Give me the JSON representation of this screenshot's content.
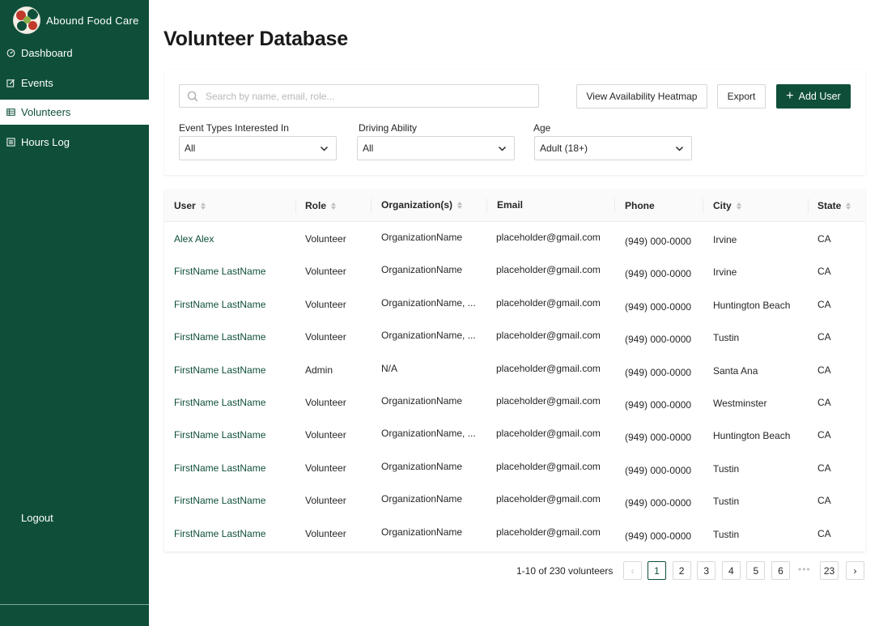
{
  "app": {
    "name": "Abound Food Care"
  },
  "sidebar": {
    "items": [
      {
        "label": "Dashboard",
        "icon": "dashboard-icon",
        "active": false
      },
      {
        "label": "Events",
        "icon": "edit-icon",
        "active": false
      },
      {
        "label": "Volunteers",
        "icon": "table-icon",
        "active": true
      },
      {
        "label": "Hours Log",
        "icon": "log-icon",
        "active": false
      }
    ],
    "logout": "Logout"
  },
  "page": {
    "title": "Volunteer Database"
  },
  "toolbar": {
    "search_placeholder": "Search by name, email, role...",
    "heatmap_label": "View Availability Heatmap",
    "export_label": "Export",
    "add_label": "Add User"
  },
  "filters": {
    "event_types": {
      "label": "Event Types Interested In",
      "value": "All"
    },
    "driving": {
      "label": "Driving Ability",
      "value": "All"
    },
    "age": {
      "label": "Age",
      "value": "Adult (18+)"
    }
  },
  "table": {
    "columns": [
      "User",
      "Role",
      "Organization(s)",
      "Email",
      "Phone",
      "City",
      "State"
    ],
    "rows": [
      {
        "user": "Alex Alex",
        "role": "Volunteer",
        "org": "OrganizationName",
        "email": "placeholder@gmail.com",
        "phone": "(949) 000-0000",
        "city": "Irvine",
        "state": "CA"
      },
      {
        "user": "FirstName LastName",
        "role": "Volunteer",
        "org": "OrganizationName",
        "email": "placeholder@gmail.com",
        "phone": "(949) 000-0000",
        "city": "Irvine",
        "state": "CA"
      },
      {
        "user": "FirstName LastName",
        "role": "Volunteer",
        "org": "OrganizationName, ...",
        "email": "placeholder@gmail.com",
        "phone": "(949) 000-0000",
        "city": "Huntington Beach",
        "state": "CA"
      },
      {
        "user": "FirstName LastName",
        "role": "Volunteer",
        "org": "OrganizationName, ...",
        "email": "placeholder@gmail.com",
        "phone": "(949) 000-0000",
        "city": "Tustin",
        "state": "CA"
      },
      {
        "user": "FirstName LastName",
        "role": "Admin",
        "org": "N/A",
        "email": "placeholder@gmail.com",
        "phone": "(949) 000-0000",
        "city": "Santa Ana",
        "state": "CA"
      },
      {
        "user": "FirstName LastName",
        "role": "Volunteer",
        "org": "OrganizationName",
        "email": "placeholder@gmail.com",
        "phone": "(949) 000-0000",
        "city": "Westminster",
        "state": "CA"
      },
      {
        "user": "FirstName LastName",
        "role": "Volunteer",
        "org": "OrganizationName, ...",
        "email": "placeholder@gmail.com",
        "phone": "(949) 000-0000",
        "city": "Huntington Beach",
        "state": "CA"
      },
      {
        "user": "FirstName LastName",
        "role": "Volunteer",
        "org": "OrganizationName",
        "email": "placeholder@gmail.com",
        "phone": "(949) 000-0000",
        "city": "Tustin",
        "state": "CA"
      },
      {
        "user": "FirstName LastName",
        "role": "Volunteer",
        "org": "OrganizationName",
        "email": "placeholder@gmail.com",
        "phone": "(949) 000-0000",
        "city": "Tustin",
        "state": "CA"
      },
      {
        "user": "FirstName LastName",
        "role": "Volunteer",
        "org": "OrganizationName",
        "email": "placeholder@gmail.com",
        "phone": "(949) 000-0000",
        "city": "Tustin",
        "state": "CA"
      }
    ]
  },
  "pagination": {
    "total_text": "1-10 of 230 volunteers",
    "pages": [
      "1",
      "2",
      "3",
      "4",
      "5",
      "6"
    ],
    "current": "1",
    "ellipsis": "•••",
    "last": "23",
    "prev": "‹",
    "next": "›"
  },
  "colors": {
    "brand": "#0f4f3a",
    "link": "#0f4f3a"
  }
}
